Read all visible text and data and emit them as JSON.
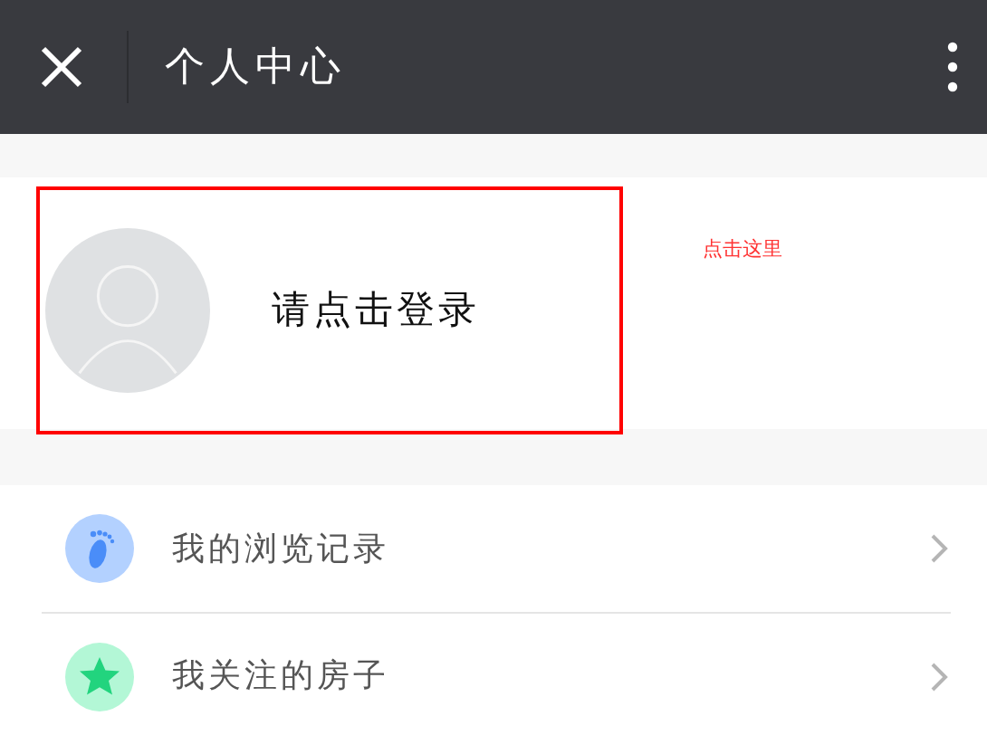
{
  "header": {
    "title": "个人中心"
  },
  "profile": {
    "login_prompt": "请点击登录"
  },
  "annotation": "点击这里",
  "menu": [
    {
      "label": "我的浏览记录",
      "kind": "footprint",
      "color": "#b3d1ff"
    },
    {
      "label": "我关注的房子",
      "kind": "star",
      "color": "#b3f7d6"
    }
  ]
}
